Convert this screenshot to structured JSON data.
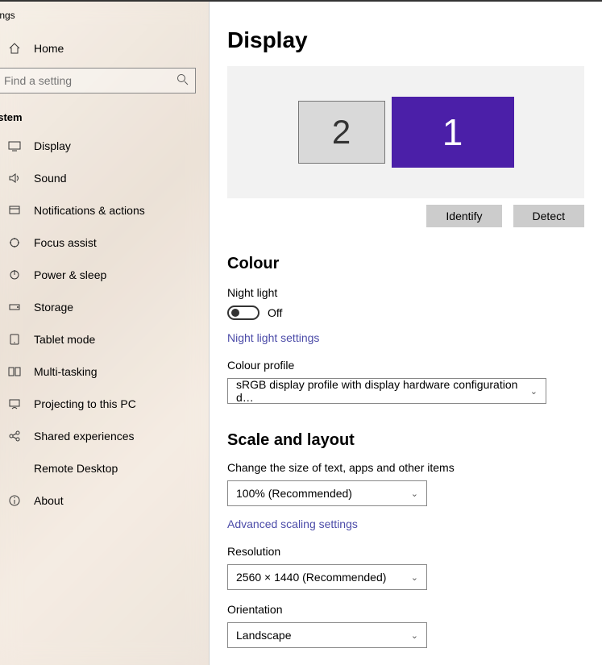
{
  "window": {
    "title": "ttings"
  },
  "sidebar": {
    "home": "Home",
    "search_placeholder": "Find a setting",
    "section": "ystem",
    "items": [
      {
        "label": "Display"
      },
      {
        "label": "Sound"
      },
      {
        "label": "Notifications & actions"
      },
      {
        "label": "Focus assist"
      },
      {
        "label": "Power & sleep"
      },
      {
        "label": "Storage"
      },
      {
        "label": "Tablet mode"
      },
      {
        "label": "Multi-tasking"
      },
      {
        "label": "Projecting to this PC"
      },
      {
        "label": "Shared experiences"
      },
      {
        "label": "Remote Desktop"
      },
      {
        "label": "About"
      }
    ]
  },
  "main": {
    "title": "Display",
    "monitors": {
      "m1": "1",
      "m2": "2"
    },
    "identify": "Identify",
    "detect": "Detect",
    "colour": {
      "heading": "Colour",
      "night_light_label": "Night light",
      "night_light_state": "Off",
      "night_light_link": "Night light settings",
      "profile_label": "Colour profile",
      "profile_value": "sRGB display profile with display hardware configuration d…"
    },
    "scale": {
      "heading": "Scale and layout",
      "size_label": "Change the size of text, apps and other items",
      "size_value": "100% (Recommended)",
      "advanced_link": "Advanced scaling settings",
      "resolution_label": "Resolution",
      "resolution_value": "2560 × 1440 (Recommended)",
      "orientation_label": "Orientation",
      "orientation_value": "Landscape"
    }
  }
}
